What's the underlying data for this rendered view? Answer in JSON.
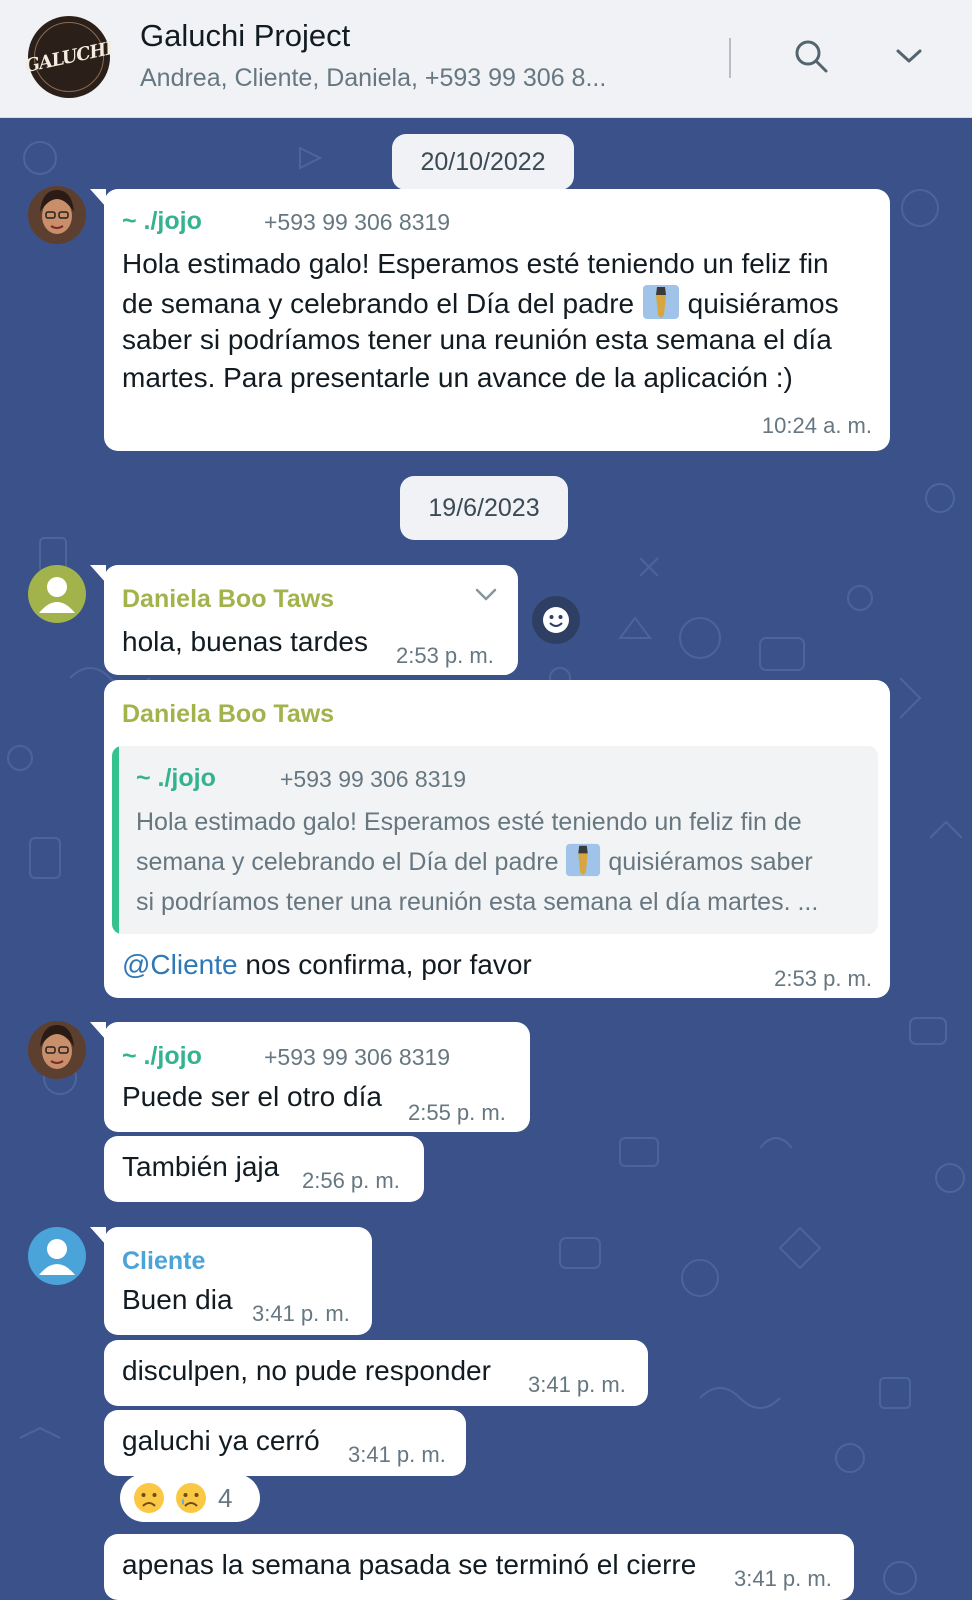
{
  "header": {
    "title": "Galuchi Project",
    "subtitle": "Andrea, Cliente, Daniela, +593 99 306 8...",
    "logo_text": "GALUCHI"
  },
  "colors": {
    "header_bg": "#f0f2f5",
    "chat_bg": "#3a5289",
    "jojo_name": "#35b28f",
    "daniela_name": "#a1b34a",
    "cliente_name": "#4aa3d9",
    "mention": "#2f78b7"
  },
  "dates": [
    "20/10/2022",
    "19/6/2023"
  ],
  "messages": [
    {
      "sender": "~ ./jojo",
      "phone": "+593 99 306 8319",
      "lines": [
        "Hola estimado galo! Esperamos esté teniendo un feliz fin",
        "de semana y celebrando el Día del padre",
        "quisiéramos",
        "saber si podríamos tener una reunión esta semana el día",
        "martes. Para presentarle un avance de la aplicación :)"
      ],
      "time": "10:24 a. m."
    },
    {
      "sender": "Daniela Boo Taws",
      "text": "hola, buenas tardes",
      "time": "2:53 p. m."
    },
    {
      "sender": "Daniela Boo Taws",
      "quote": {
        "sender": "~ ./jojo",
        "phone": "+593 99 306 8319",
        "line1": "Hola estimado galo! Esperamos esté teniendo un feliz fin de",
        "line2a": "semana y celebrando el Día del padre",
        "line2b": "quisiéramos saber",
        "line3": "si podríamos tener una reunión esta semana el día martes. ..."
      },
      "mention": "@Cliente",
      "text": " nos confirma, por favor",
      "time": "2:53 p. m."
    },
    {
      "sender": "~ ./jojo",
      "phone": "+593 99 306 8319",
      "text": "Puede ser el otro día",
      "time": "2:55 p. m."
    },
    {
      "text": "También jaja",
      "time": "2:56 p. m."
    },
    {
      "sender": "Cliente",
      "text": "Buen dia",
      "time": "3:41 p. m."
    },
    {
      "text": "disculpen, no pude responder",
      "time": "3:41 p. m."
    },
    {
      "text": "galuchi ya cerró",
      "time": "3:41 p. m.",
      "reaction_count": "4"
    },
    {
      "text": "apenas la semana pasada se terminó el cierre",
      "time": "3:41 p. m."
    }
  ]
}
